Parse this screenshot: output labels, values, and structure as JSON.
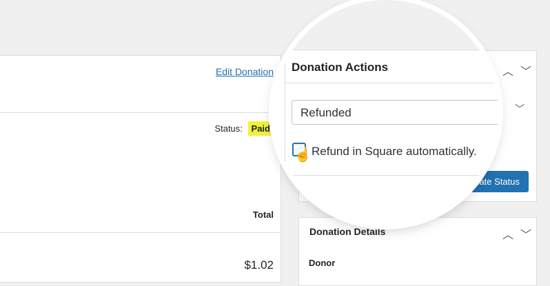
{
  "main": {
    "edit_link": "Edit Donation",
    "status_label": "Status:",
    "status_value": "Paid",
    "total_header": "Total",
    "amount": "$1.02"
  },
  "donation_actions": {
    "title": "Donation Actions",
    "selected_status": "Refunded",
    "checkbox_label": "Refund in Square automatically.",
    "checkbox_checked": true,
    "update_button": "Update Status",
    "update_button_partial": "date Status"
  },
  "donation_details": {
    "title": "Donation Details",
    "donor_label": "Donor"
  },
  "icons": {
    "collapse": "chevron-up-icon",
    "expand": "chevron-down-icon",
    "select_arrow": "chevron-down-icon",
    "cursor": "hand-pointer-icon"
  },
  "colors": {
    "accent": "#2271b1",
    "paid_highlight": "#f0f33a",
    "background": "#f0f0f1"
  }
}
